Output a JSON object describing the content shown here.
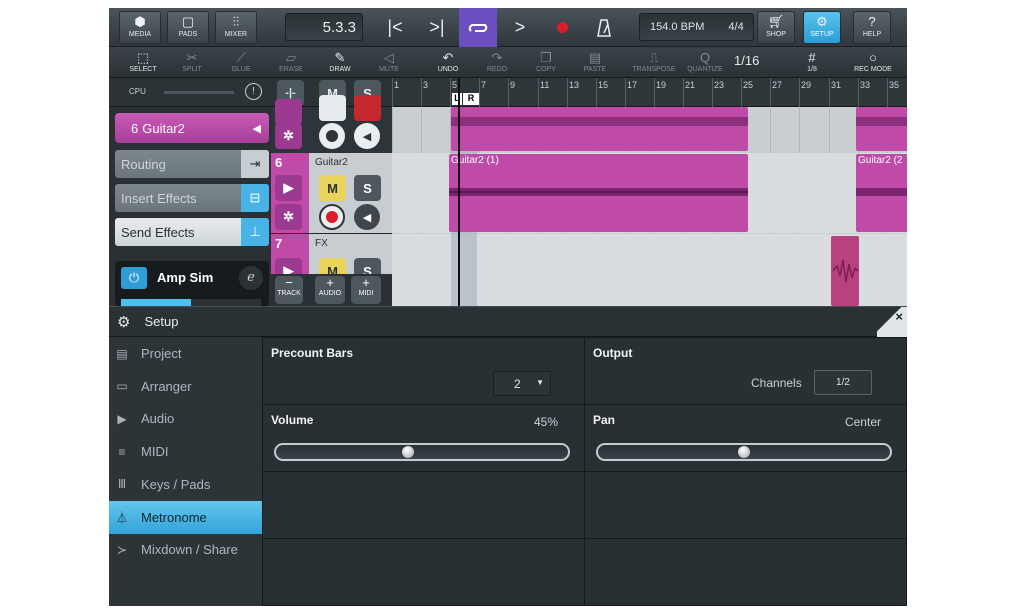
{
  "toolbar": {
    "media": "MEDIA",
    "pads": "PADS",
    "mixer": "MIXER",
    "position": "5.3.3",
    "tempo": "154.0 BPM",
    "signature": "4/4",
    "shop": "SHOP",
    "setup": "SETUP",
    "help": "HELP"
  },
  "edit_toolbar": {
    "select": "SELECT",
    "split": "SPLIT",
    "glue": "GLUE",
    "erase": "ERASE",
    "draw": "DRAW",
    "mute": "MUTE",
    "undo": "UNDO",
    "redo": "REDO",
    "copy": "COPY",
    "paste": "PASTE",
    "transpose": "TRANSPOSE",
    "quantize": "QUANTIZE",
    "quantize_value": "1/16",
    "grid": "1/8",
    "rec_mode": "REC MODE"
  },
  "cpu_label": "CPU",
  "ruler": {
    "numbers": [
      "1",
      "3",
      "5",
      "7",
      "9",
      "11",
      "13",
      "15",
      "17",
      "19",
      "21",
      "23",
      "25",
      "27",
      "29",
      "31",
      "33",
      "35"
    ],
    "locator_left": "L",
    "locator_right": "R"
  },
  "inspector": {
    "track_number": "6",
    "track_name": "Guitar2",
    "routing": "Routing",
    "insert_effects": "Insert Effects",
    "send_effects": "Send Effects",
    "plugin": "Amp Sim",
    "plugin_edit": "e"
  },
  "tracks": [
    {
      "number": "6",
      "name": "Guitar2",
      "mute": "M",
      "solo": "S"
    },
    {
      "number": "7",
      "name": "FX",
      "mute": "M",
      "solo": "S"
    }
  ],
  "track_buttons": {
    "track": "TRACK",
    "audio": "AUDIO",
    "midi": "MIDI",
    "minus": "−",
    "plus": "+"
  },
  "clips": [
    {
      "name": "Guitar2 (1)"
    },
    {
      "name": "Guitar2 (2"
    }
  ],
  "setup": {
    "title": "Setup",
    "close": "×",
    "nav": [
      {
        "label": "Project",
        "icon": "project-icon"
      },
      {
        "label": "Arranger",
        "icon": "arranger-icon"
      },
      {
        "label": "Audio",
        "icon": "audio-icon"
      },
      {
        "label": "MIDI",
        "icon": "midi-icon"
      },
      {
        "label": "Keys / Pads",
        "icon": "keys-icon"
      },
      {
        "label": "Metronome",
        "icon": "metronome-icon",
        "active": true
      },
      {
        "label": "Mixdown / Share",
        "icon": "share-icon"
      }
    ],
    "precount_label": "Precount Bars",
    "precount_value": "2",
    "output_label": "Output",
    "channels_label": "Channels",
    "channels_value": "1/2",
    "volume_label": "Volume",
    "volume_value": "45%",
    "volume_level": 0.45,
    "pan_label": "Pan",
    "pan_value": "Center",
    "pan_level": 0.5
  },
  "colors": {
    "accent": "#33a3d8",
    "track_magenta": "#c04aa8",
    "loop_purple": "#6b4fc0",
    "record_red": "#d8202a"
  }
}
